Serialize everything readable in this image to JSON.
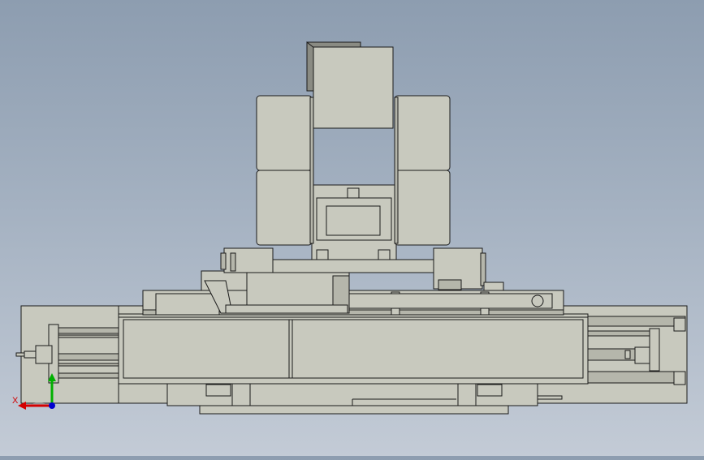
{
  "viewport": {
    "background_top": "#8d9db0",
    "background_bottom": "#c3cbd6",
    "model_fill": "#c8c9be",
    "model_dark_fill": "#b5b6ab",
    "edge_color": "#1a1a1a"
  },
  "triad": {
    "x_label": "X",
    "x_color": "#d40000",
    "y_color": "#00b000",
    "z_color": "#0000d0"
  }
}
